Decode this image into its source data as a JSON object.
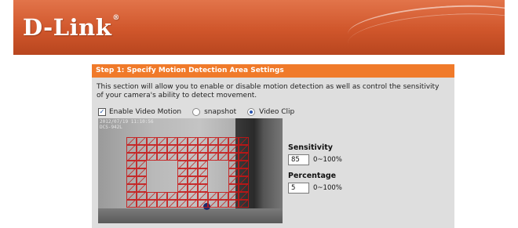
{
  "header": {
    "logo_text": "D-Link",
    "logo_reg": "®",
    "brand_color": "#d0562b"
  },
  "panel": {
    "title": "Step 1: Specify Motion Detection Area Settings",
    "title_color": "#f07a2a",
    "description": "This section will allow you to enable or disable motion detection as well as control the sensitivity of your camera's ability to detect movement.",
    "enable_label": "Enable Video Motion",
    "enable_checked": true,
    "mode_options": [
      "snapshot",
      "Video Clip"
    ],
    "mode_selected": "Video Clip"
  },
  "camera": {
    "timestamp_line1": "2012/07/19 11:10:56",
    "timestamp_line2": "DCS-942L",
    "grid_color": "#c81414",
    "grid_cols": 12,
    "grid_rows": 9,
    "grid_cells": [
      "111111111111",
      "111111111111",
      "111111111111",
      "110001110011",
      "110001110011",
      "110001110011",
      "110001110011",
      "111111111111",
      "111111111111"
    ]
  },
  "settings": {
    "sensitivity_label": "Sensitivity",
    "sensitivity_value": "85",
    "sensitivity_range": "0~100%",
    "percentage_label": "Percentage",
    "percentage_value": "5",
    "percentage_range": "0~100%"
  }
}
